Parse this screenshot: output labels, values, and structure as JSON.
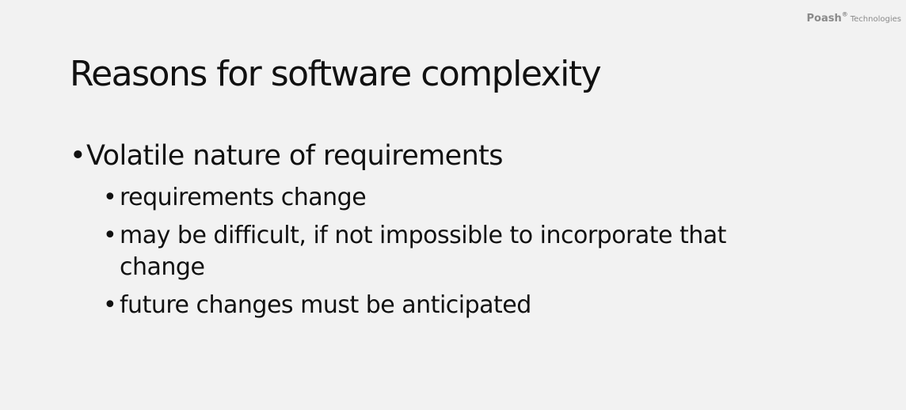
{
  "logo": {
    "brand": "Poash",
    "reg": "®",
    "suffix": "Technologies"
  },
  "slide": {
    "title": "Reasons for software complexity",
    "bullets": [
      {
        "text": "Volatile nature of requirements",
        "sub": [
          "requirements change",
          "may be difficult, if not impossible to incorporate that change",
          "future changes must be anticipated"
        ]
      }
    ],
    "bullet_glyph": "•"
  }
}
